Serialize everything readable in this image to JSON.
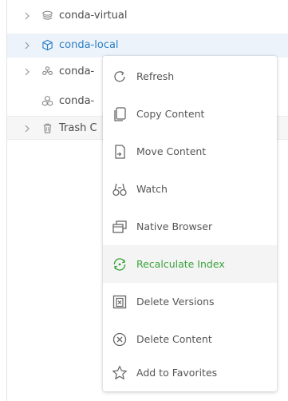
{
  "tree": {
    "items": [
      {
        "label": "conda-virtual",
        "icon": "stacked-layers-icon",
        "expandable": true,
        "selected": false
      },
      {
        "label": "conda-local",
        "icon": "cube-icon",
        "expandable": true,
        "selected": true
      },
      {
        "label": "conda-",
        "icon": "atom-icon",
        "expandable": true,
        "selected": false
      },
      {
        "label": "conda-",
        "icon": "cube-cluster-icon",
        "expandable": false,
        "selected": false
      },
      {
        "label": "Trash C",
        "icon": "trash-icon",
        "expandable": true,
        "selected": false
      }
    ]
  },
  "context_menu": {
    "items": [
      {
        "label": "Refresh",
        "icon": "refresh-icon"
      },
      {
        "label": "Copy Content",
        "icon": "copy-icon"
      },
      {
        "label": "Move Content",
        "icon": "move-icon"
      },
      {
        "label": "Watch",
        "icon": "binoculars-icon"
      },
      {
        "label": "Native Browser",
        "icon": "native-browser-icon"
      },
      {
        "label": "Recalculate Index",
        "icon": "recalculate-icon",
        "active": true
      },
      {
        "label": "Delete Versions",
        "icon": "delete-versions-icon"
      },
      {
        "label": "Delete Content",
        "icon": "delete-content-icon"
      },
      {
        "label": "Add to Favorites",
        "icon": "star-icon"
      }
    ]
  },
  "colors": {
    "selected_text": "#2d7ec3",
    "selected_bg": "#edf3fa",
    "active_menu_text": "#39a33b",
    "menu_text": "#555555",
    "tree_text": "#4b4b4b"
  }
}
